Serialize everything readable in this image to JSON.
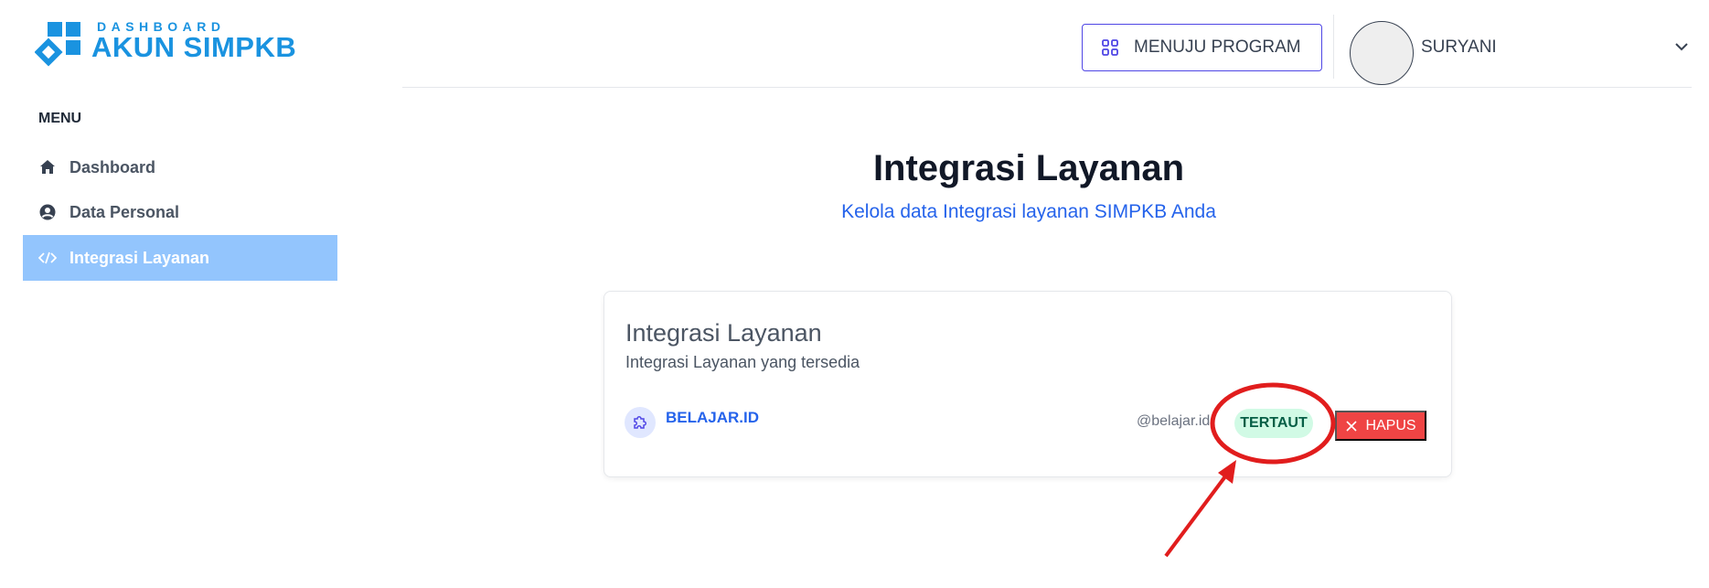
{
  "logo": {
    "small": "DASHBOARD",
    "big": "AKUN SIMPKB",
    "color": "#1a93e0"
  },
  "sidebar": {
    "heading": "MENU",
    "items": [
      {
        "label": "Dashboard",
        "icon": "home-icon",
        "active": false
      },
      {
        "label": "Data Personal",
        "icon": "user-circle-icon",
        "active": false
      },
      {
        "label": "Integrasi Layanan",
        "icon": "code-icon",
        "active": true
      }
    ]
  },
  "header": {
    "program_button": "MENUJU PROGRAM",
    "program_icon": "grid-icon",
    "user_name": "SURYANI",
    "dropdown_icon": "chevron-down-icon"
  },
  "main": {
    "title": "Integrasi Layanan",
    "subtitle": "Kelola data Integrasi layanan SIMPKB Anda",
    "card": {
      "title": "Integrasi Layanan",
      "subtitle": "Integrasi Layanan yang tersedia",
      "service": {
        "icon": "puzzle-icon",
        "name": "BELAJAR.ID",
        "account": "@belajar.id",
        "status": "TERTAUT",
        "remove_label": "HAPUS"
      }
    }
  },
  "colors": {
    "active_nav": "#93c5fd",
    "accent": "#2563eb",
    "danger": "#ef4444",
    "success_bg": "#d1fae5",
    "annotation": "#e11d1d"
  }
}
